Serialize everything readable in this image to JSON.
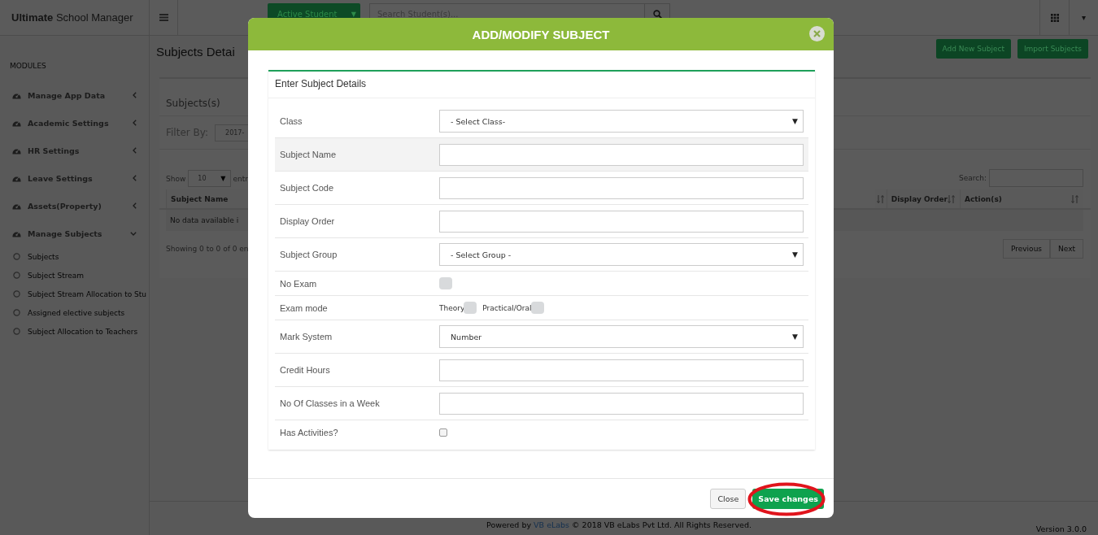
{
  "topbar": {
    "brand": "**Ultimate** School Manager",
    "student_button": "Active Student",
    "student_caret": "▼",
    "search": {
      "placeholder": "Search Student(s)..."
    },
    "user_caret": "▾"
  },
  "sidebar": {
    "heading": "MODULES",
    "items": [
      {
        "label": "Manage App Data",
        "expanded": false
      },
      {
        "label": "Academic Settings",
        "expanded": false
      },
      {
        "label": "HR Settings",
        "expanded": false
      },
      {
        "label": "Leave Settings",
        "expanded": false
      },
      {
        "label": "Assets(Property)",
        "expanded": false
      },
      {
        "label": "Manage Subjects",
        "expanded": true,
        "children": [
          {
            "label": "Subjects"
          },
          {
            "label": "Subject Stream"
          },
          {
            "label": "Subject Stream Allocation to Stu"
          },
          {
            "label": "Assigned elective subjects"
          },
          {
            "label": "Subject Allocation to Teachers"
          }
        ]
      }
    ]
  },
  "page": {
    "title": "Subjects Detai",
    "buttons": [
      "Add New Subject",
      "Import Subjects"
    ],
    "card_title": "Subjects(s)",
    "filter_label": "Filter By:",
    "filter_value": "2017-",
    "show_label": "Show",
    "page_size": "10",
    "page_size_caret": "▼",
    "entries_label": "entr",
    "search_label": "Search:",
    "columns": [
      "Subject Name",
      "Display Order",
      "Action(s)"
    ],
    "empty_text": "No data available i",
    "info": "Showing 0 to 0 of 0 en",
    "pagination": [
      "Previous",
      "Next"
    ]
  },
  "footer": {
    "text": "Powered by ",
    "link": "VB eLabs",
    "rest": " © 2018 VB eLabs Pvt Ltd. All Rights Reserved.",
    "version": "Version 3.0.0"
  },
  "modal": {
    "title": "ADD/MODIFY SUBJECT",
    "panel_title": "Enter Subject Details",
    "rows": [
      {
        "label": "Class",
        "kind": "select",
        "value": "- Select Class-",
        "highlighted": false
      },
      {
        "label": "Subject Name",
        "kind": "text",
        "highlighted": true
      },
      {
        "label": "Subject Code",
        "kind": "text",
        "highlighted": false
      },
      {
        "label": "Display Order",
        "kind": "text",
        "highlighted": false
      },
      {
        "label": "Subject Group",
        "kind": "select",
        "value": "- Select Group -",
        "highlighted": false
      },
      {
        "label": "No Exam",
        "kind": "toggle",
        "checked": false,
        "highlighted": false
      },
      {
        "label": "Exam mode",
        "kind": "toggles",
        "highlighted": false,
        "options": [
          {
            "label": "Theory",
            "checked": false
          },
          {
            "label": "Practical/Oral",
            "checked": false
          }
        ]
      },
      {
        "label": "Mark System",
        "kind": "select",
        "value": "Number",
        "highlighted": false
      },
      {
        "label": "Credit Hours",
        "kind": "text",
        "highlighted": false
      },
      {
        "label": "No Of Classes in a Week",
        "kind": "text",
        "highlighted": false
      },
      {
        "label": "Has Activities?",
        "kind": "checkbox",
        "checked": false,
        "highlighted": false
      }
    ],
    "select_caret": "▼",
    "buttons": [
      {
        "label": "Close",
        "kind": "default"
      },
      {
        "label": "Save changes",
        "kind": "primary",
        "circled": true
      }
    ]
  }
}
